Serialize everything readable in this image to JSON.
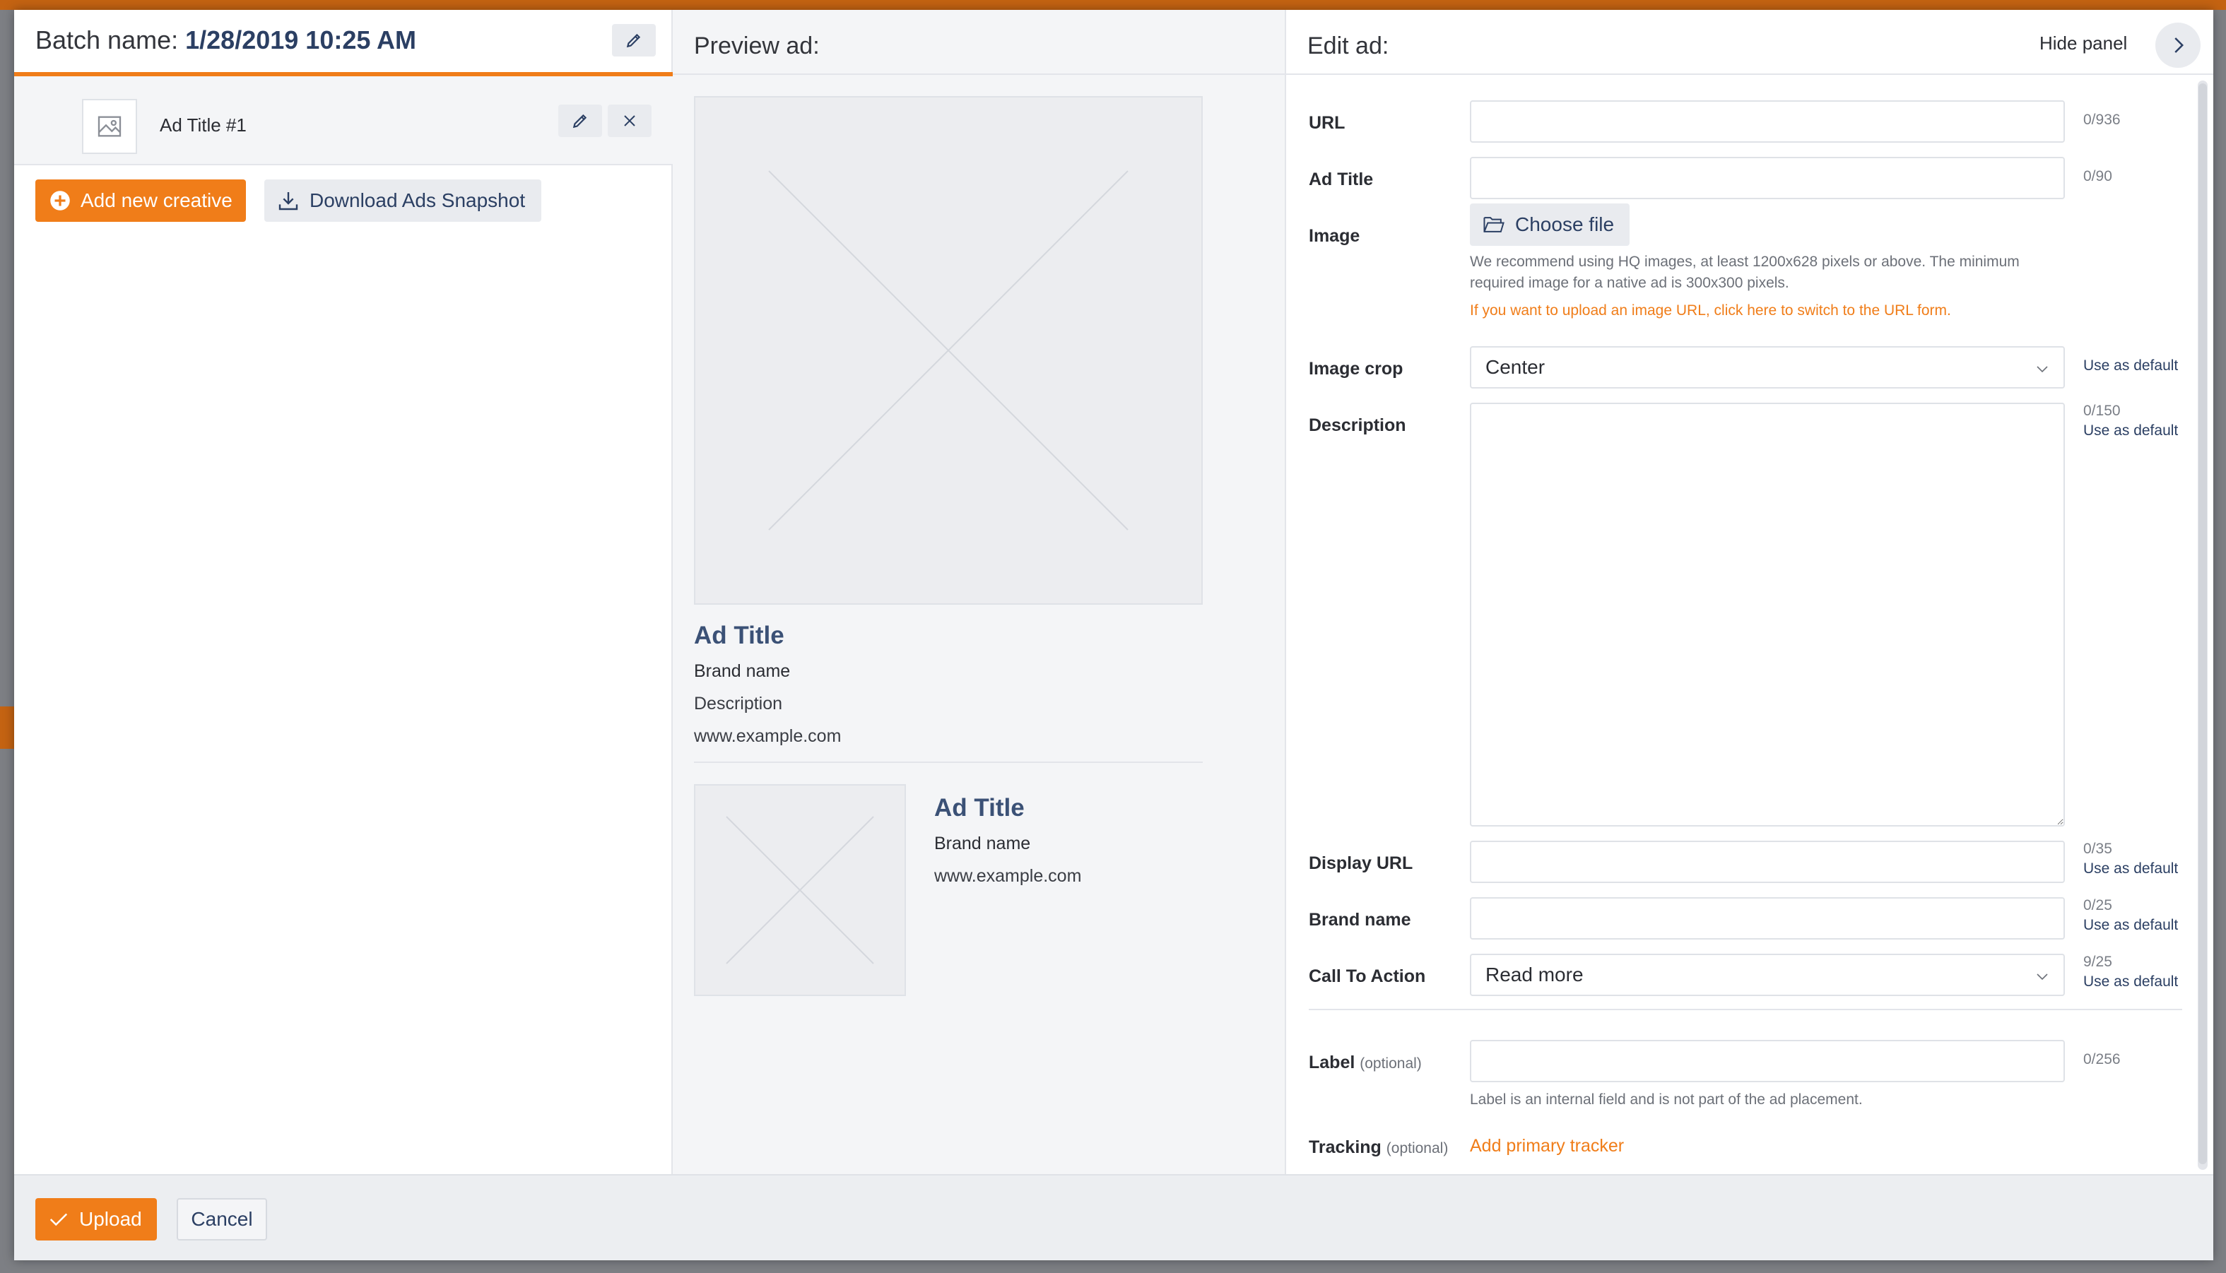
{
  "batch": {
    "label": "Batch name:",
    "value": "1/28/2019 10:25 AM"
  },
  "creative": {
    "title": "Ad Title #1"
  },
  "left_actions": {
    "add_creative": "Add new creative",
    "download_snapshot": "Download Ads Snapshot"
  },
  "preview": {
    "heading": "Preview ad:",
    "large": {
      "title": "Ad Title",
      "brand": "Brand name",
      "description": "Description",
      "url": "www.example.com"
    },
    "small": {
      "title": "Ad Title",
      "brand": "Brand name",
      "url": "www.example.com"
    }
  },
  "edit": {
    "heading": "Edit ad:",
    "hide_panel": "Hide panel",
    "use_default": "Use as default",
    "url": {
      "label": "URL",
      "counter": "0/936",
      "value": ""
    },
    "ad_title": {
      "label": "Ad Title",
      "counter": "0/90",
      "value": ""
    },
    "image": {
      "label": "Image",
      "choose_file": "Choose file",
      "hint": "We recommend using HQ images, at least 1200x628 pixels or above. The minimum required image for a native ad is 300x300 pixels.",
      "switch_link": "If you want to upload an image URL, click here to switch to the URL form."
    },
    "image_crop": {
      "label": "Image crop",
      "value": "Center"
    },
    "description": {
      "label": "Description",
      "counter": "0/150",
      "value": ""
    },
    "display_url": {
      "label": "Display URL",
      "counter": "0/35",
      "value": ""
    },
    "brand_name": {
      "label": "Brand name",
      "counter": "0/25",
      "value": ""
    },
    "cta": {
      "label": "Call To Action",
      "counter": "9/25",
      "value": "Read more"
    },
    "label_field": {
      "label": "Label",
      "optional": "(optional)",
      "counter": "0/256",
      "hint": "Label is an internal field and is not part of the ad placement.",
      "value": ""
    },
    "tracking": {
      "label": "Tracking",
      "optional": "(optional)",
      "add_link": "Add primary tracker"
    }
  },
  "footer": {
    "upload": "Upload",
    "cancel": "Cancel"
  },
  "colors": {
    "accent": "#f07d19",
    "navy": "#2b3f63",
    "title_blue": "#3b5176"
  }
}
